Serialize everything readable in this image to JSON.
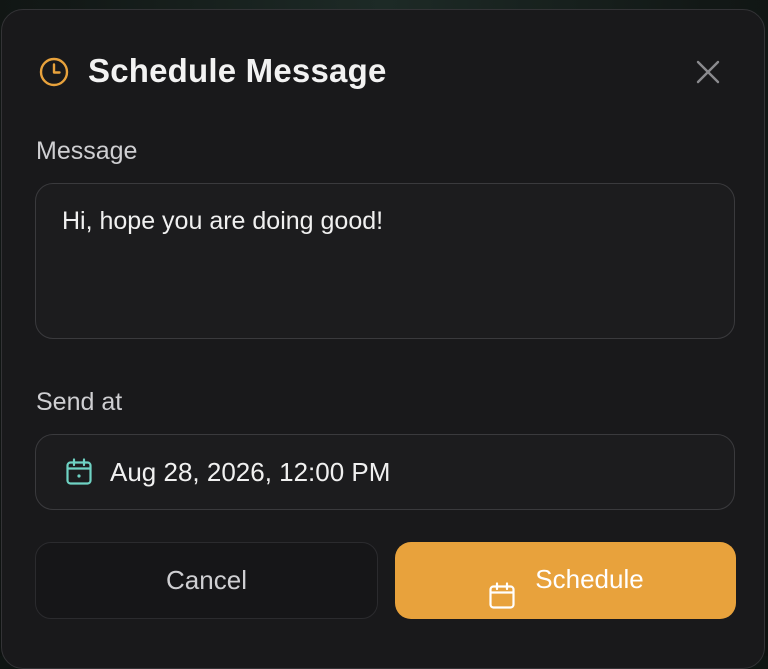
{
  "dialog": {
    "title": "Schedule Message",
    "header_icon": "clock-icon",
    "close_icon": "close-icon",
    "accent_color": "#e8a23c"
  },
  "message": {
    "label": "Message",
    "value": "Hi, hope you are doing good!"
  },
  "send_at": {
    "label": "Send at",
    "icon": "calendar-icon",
    "value": "Aug 28, 2026, 12:00 PM"
  },
  "actions": {
    "cancel_label": "Cancel",
    "schedule_label": "Schedule",
    "schedule_icon": "calendar-icon"
  }
}
